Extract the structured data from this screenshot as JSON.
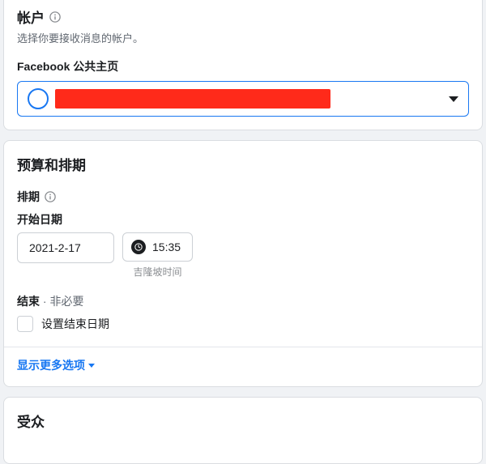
{
  "account": {
    "title": "帐户",
    "subtitle": "选择你要接收消息的帐户。",
    "page_field_label": "Facebook 公共主页",
    "selected_page": ""
  },
  "budget": {
    "title": "预算和排期",
    "schedule_label": "排期",
    "start_date_label": "开始日期",
    "start_date": "2021-2-17",
    "start_time": "15:35",
    "timezone_note": "吉隆坡时间",
    "end_label": "结束",
    "end_optional": "· 非必要",
    "set_end_label": "设置结束日期",
    "show_more": "显示更多选项"
  },
  "audience": {
    "title": "受众"
  }
}
